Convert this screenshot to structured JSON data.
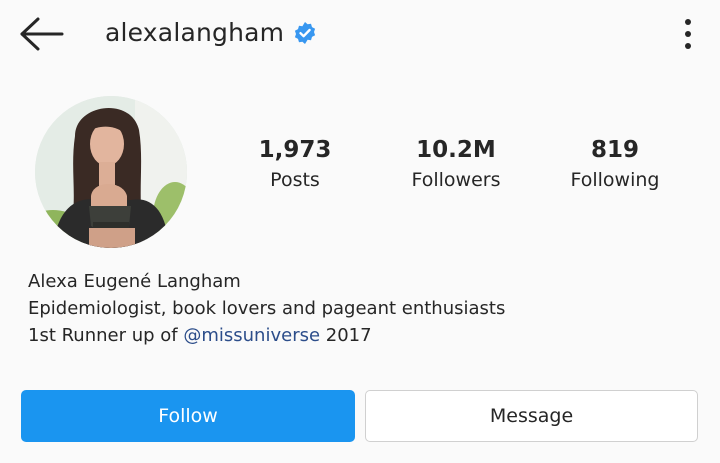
{
  "header": {
    "username": "alexalangham",
    "back_icon": "arrow-left-icon",
    "verified_icon": "verified-badge-icon",
    "more_icon": "more-vertical-icon"
  },
  "profile": {
    "avatar": "profile-photo",
    "stats": [
      {
        "value": "1,973",
        "label": "Posts"
      },
      {
        "value": "10.2M",
        "label": "Followers"
      },
      {
        "value": "819",
        "label": "Following"
      }
    ]
  },
  "bio": {
    "name": "Alexa Eugené Langham",
    "line1": "Epidemiologist, book lovers and pageant enthusiasts",
    "line2_prefix": "1st Runner up of ",
    "mention": "@missuniverse",
    "line2_suffix": " 2017"
  },
  "actions": {
    "follow_label": "Follow",
    "message_label": "Message"
  },
  "colors": {
    "background": "#fafafa",
    "follow_button": "#1a95f0",
    "verified_badge": "#3897f0",
    "mention_link": "#2c4d8a"
  }
}
